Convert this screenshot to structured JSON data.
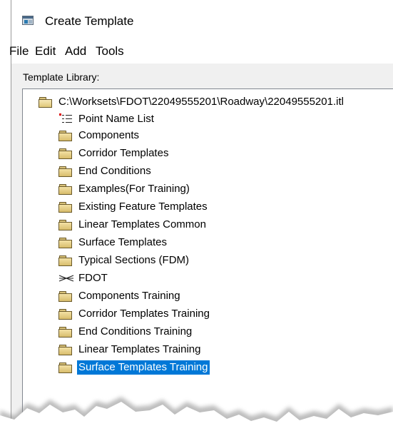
{
  "window": {
    "title": "Create Template"
  },
  "menu": [
    "File",
    "Edit",
    "Add",
    "Tools"
  ],
  "library": {
    "label": "Template Library:",
    "root_path": "C:\\Worksets\\FDOT\\22049555201\\Roadway\\22049555201.itl",
    "items": [
      {
        "label": "Point Name List",
        "icon": "point-list-icon"
      },
      {
        "label": "Components",
        "icon": "folder-icon"
      },
      {
        "label": "Corridor Templates",
        "icon": "folder-icon"
      },
      {
        "label": "End Conditions",
        "icon": "folder-icon"
      },
      {
        "label": "Examples(For Training)",
        "icon": "folder-icon"
      },
      {
        "label": "Existing Feature Templates",
        "icon": "folder-icon"
      },
      {
        "label": "Linear Templates Common",
        "icon": "folder-icon"
      },
      {
        "label": "Surface Templates",
        "icon": "folder-icon"
      },
      {
        "label": "Typical Sections (FDM)",
        "icon": "folder-icon"
      },
      {
        "label": "FDOT",
        "icon": "template-icon"
      },
      {
        "label": "Components Training",
        "icon": "folder-icon"
      },
      {
        "label": "Corridor Templates Training",
        "icon": "folder-icon"
      },
      {
        "label": "End Conditions Training",
        "icon": "folder-icon"
      },
      {
        "label": "Linear Templates Training",
        "icon": "folder-icon"
      },
      {
        "label": "Surface Templates Training",
        "icon": "folder-icon",
        "selected": true
      }
    ]
  },
  "colors": {
    "selection": "#0078d7",
    "folder": "#e8cf85"
  }
}
